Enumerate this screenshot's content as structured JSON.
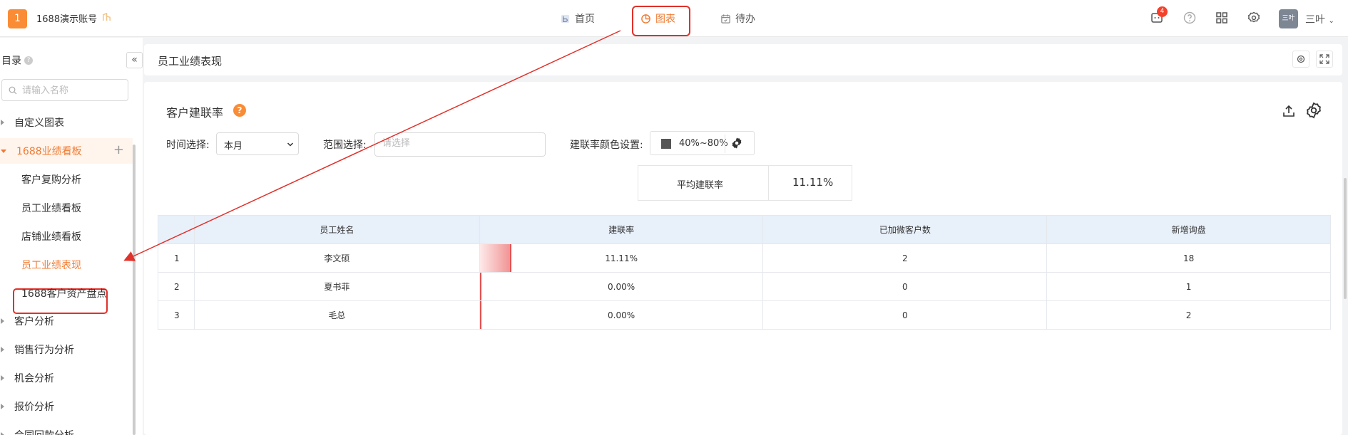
{
  "header": {
    "logo": "1",
    "account": "1688演示账号",
    "tabs": [
      {
        "label": "首页"
      },
      {
        "label": "图表"
      },
      {
        "label": "待办"
      }
    ],
    "message_count": "4",
    "avatar_text": "三叶",
    "user_name": "三叶"
  },
  "sidebar": {
    "title": "目录",
    "search_placeholder": "请输入名称",
    "items": [
      {
        "label": "自定义图表"
      },
      {
        "label": "1688业绩看板"
      },
      {
        "label": "客户复购分析"
      },
      {
        "label": "员工业绩看板"
      },
      {
        "label": "店铺业绩看板"
      },
      {
        "label": "员工业绩表现"
      },
      {
        "label": "1688客户资产盘点"
      },
      {
        "label": "客户分析"
      },
      {
        "label": "销售行为分析"
      },
      {
        "label": "机会分析"
      },
      {
        "label": "报价分析"
      },
      {
        "label": "合同回款分析"
      }
    ]
  },
  "page": {
    "title": "员工业绩表现"
  },
  "card": {
    "title": "客户建联率",
    "help": "?",
    "time_label": "时间选择:",
    "time_value": "本月",
    "range_label": "范围选择:",
    "range_placeholder": "请选择",
    "color_label": "建联率颜色设置:",
    "color_range": "40%~80%",
    "avg_label": "平均建联率",
    "avg_value": "11.11%"
  },
  "table": {
    "columns": [
      "员工姓名",
      "建联率",
      "已加微客户数",
      "新增询盘"
    ],
    "rows": [
      {
        "idx": "1",
        "name": "李文硕",
        "rate": "11.11%",
        "rate_fraction": 0.111,
        "wechat": "2",
        "inquiries": "18"
      },
      {
        "idx": "2",
        "name": "夏书菲",
        "rate": "0.00%",
        "rate_fraction": 0,
        "wechat": "0",
        "inquiries": "1"
      },
      {
        "idx": "3",
        "name": "毛总",
        "rate": "0.00%",
        "rate_fraction": 0,
        "wechat": "0",
        "inquiries": "2"
      }
    ]
  },
  "colors": {
    "accent": "#f07a31",
    "annotation": "#e0312a",
    "bar": "#e35050"
  }
}
